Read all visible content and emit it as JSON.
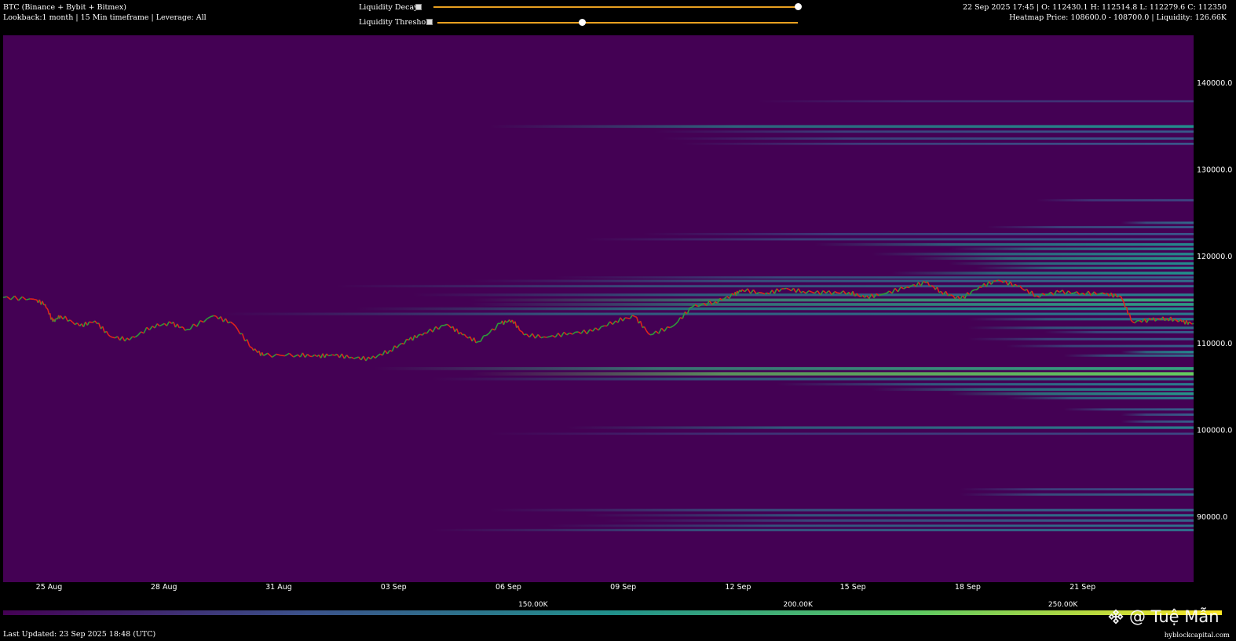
{
  "header": {
    "instrument": "BTC (Binance + Bybit + Bitmex)",
    "lookback": "Lookback:1 month | 15 Min timeframe | Leverage: All",
    "ohlc": "22 Sep 2025 17:45 | O: 112430.1 H: 112514.8 L: 112279.6 C: 112350",
    "heatmap_info": "Heatmap Price: 108600.0 - 108700.0 | Liquidity: 126.66K"
  },
  "controls": {
    "liquidity_decay": {
      "label": "Liquidity Decay",
      "value": 1.0
    },
    "liquidity_threshold": {
      "label": "Liquidity Threshold",
      "value": 0.4
    }
  },
  "footer": {
    "last_updated": "Last Updated: 23 Sep 2025 18:48 (UTC)",
    "site": "hyblockcapital.com"
  },
  "watermark": {
    "text": "@ Tuệ Mẫn"
  },
  "colors": {
    "background": "#440154",
    "price_up": "#2e9b3a",
    "price_down": "#e0241b",
    "slider": "#e8a020"
  },
  "chart_data": {
    "type": "heatmap",
    "x_ticks": [
      "25 Aug",
      "28 Aug",
      "31 Aug",
      "03 Sep",
      "06 Sep",
      "09 Sep",
      "12 Sep",
      "15 Sep",
      "18 Sep",
      "21 Sep"
    ],
    "x_tick_days": [
      2,
      5,
      8,
      11,
      14,
      17,
      20,
      23,
      26,
      29
    ],
    "x_range_days": [
      0.8,
      31.9
    ],
    "y_ticks": [
      "140000.0",
      "130000.0",
      "120000.0",
      "110000.0",
      "100000.0",
      "90000.0"
    ],
    "y_tick_values": [
      140000,
      130000,
      120000,
      110000,
      100000,
      90000
    ],
    "ylim": [
      82500,
      145500
    ],
    "colorbar": {
      "labels": [
        "150.00K",
        "200.00K",
        "250.00K"
      ],
      "label_values": [
        150000,
        200000,
        250000
      ],
      "range": [
        50000,
        280000
      ]
    },
    "price_path": [
      [
        0.8,
        115300
      ],
      [
        1.6,
        115100
      ],
      [
        1.9,
        114500
      ],
      [
        2.1,
        112500
      ],
      [
        2.3,
        113200
      ],
      [
        2.8,
        112000
      ],
      [
        3.2,
        112600
      ],
      [
        3.6,
        110800
      ],
      [
        4.1,
        110400
      ],
      [
        4.7,
        112000
      ],
      [
        5.2,
        112300
      ],
      [
        5.6,
        111600
      ],
      [
        6.3,
        113200
      ],
      [
        6.8,
        112300
      ],
      [
        7.3,
        109500
      ],
      [
        7.6,
        108600
      ],
      [
        8.5,
        108700
      ],
      [
        9.0,
        108500
      ],
      [
        9.4,
        108700
      ],
      [
        9.9,
        108400
      ],
      [
        10.4,
        108200
      ],
      [
        10.9,
        109200
      ],
      [
        11.4,
        110400
      ],
      [
        11.8,
        111200
      ],
      [
        12.4,
        112200
      ],
      [
        12.8,
        111000
      ],
      [
        13.2,
        110200
      ],
      [
        13.8,
        112300
      ],
      [
        14.1,
        112700
      ],
      [
        14.4,
        111000
      ],
      [
        15.0,
        110700
      ],
      [
        15.6,
        111200
      ],
      [
        16.2,
        111400
      ],
      [
        16.8,
        112600
      ],
      [
        17.3,
        113100
      ],
      [
        17.7,
        111000
      ],
      [
        18.3,
        112000
      ],
      [
        18.8,
        114200
      ],
      [
        19.4,
        114800
      ],
      [
        19.9,
        115600
      ],
      [
        20.1,
        116200
      ],
      [
        20.7,
        115700
      ],
      [
        21.2,
        116300
      ],
      [
        21.7,
        116000
      ],
      [
        22.3,
        115800
      ],
      [
        22.9,
        115900
      ],
      [
        23.3,
        115300
      ],
      [
        23.8,
        115700
      ],
      [
        24.4,
        116500
      ],
      [
        24.9,
        117000
      ],
      [
        25.3,
        116000
      ],
      [
        25.8,
        115100
      ],
      [
        26.3,
        116500
      ],
      [
        26.8,
        117300
      ],
      [
        27.3,
        116600
      ],
      [
        27.8,
        115500
      ],
      [
        28.4,
        115900
      ],
      [
        29.0,
        115800
      ],
      [
        29.6,
        115700
      ],
      [
        30.0,
        115400
      ],
      [
        30.3,
        112500
      ],
      [
        30.8,
        112700
      ],
      [
        31.2,
        112900
      ],
      [
        31.6,
        112500
      ],
      [
        31.9,
        112300
      ]
    ],
    "liquidity_bands": [
      {
        "price": 137900,
        "start_day": 20.5,
        "intensity": 0.18
      },
      {
        "price": 135000,
        "start_day": 13.5,
        "intensity": 0.48
      },
      {
        "price": 134400,
        "start_day": 17.8,
        "intensity": 0.28
      },
      {
        "price": 133600,
        "start_day": 18.0,
        "intensity": 0.28
      },
      {
        "price": 133000,
        "start_day": 18.5,
        "intensity": 0.26
      },
      {
        "price": 126500,
        "start_day": 27.8,
        "intensity": 0.22
      },
      {
        "price": 123900,
        "start_day": 30.0,
        "intensity": 0.34
      },
      {
        "price": 123400,
        "start_day": 26.5,
        "intensity": 0.28
      },
      {
        "price": 122600,
        "start_day": 17.5,
        "intensity": 0.26
      },
      {
        "price": 122000,
        "start_day": 16.0,
        "intensity": 0.28
      },
      {
        "price": 121400,
        "start_day": 22.0,
        "intensity": 0.46
      },
      {
        "price": 120900,
        "start_day": 25.5,
        "intensity": 0.46
      },
      {
        "price": 120300,
        "start_day": 23.5,
        "intensity": 0.46
      },
      {
        "price": 119800,
        "start_day": 24.5,
        "intensity": 0.52
      },
      {
        "price": 119200,
        "start_day": 25.5,
        "intensity": 0.46
      },
      {
        "price": 118700,
        "start_day": 26.2,
        "intensity": 0.46
      },
      {
        "price": 118100,
        "start_day": 24.0,
        "intensity": 0.5
      },
      {
        "price": 117600,
        "start_day": 15.2,
        "intensity": 0.32
      },
      {
        "price": 117200,
        "start_day": 13.0,
        "intensity": 0.36
      },
      {
        "price": 116600,
        "start_day": 9.5,
        "intensity": 0.34
      },
      {
        "price": 115600,
        "start_day": 11.5,
        "intensity": 0.42
      },
      {
        "price": 115000,
        "start_day": 13.0,
        "intensity": 0.6
      },
      {
        "price": 114500,
        "start_day": 13.0,
        "intensity": 0.55
      },
      {
        "price": 114000,
        "start_day": 10.0,
        "intensity": 0.5
      },
      {
        "price": 113400,
        "start_day": 6.5,
        "intensity": 0.4
      },
      {
        "price": 112800,
        "start_day": 26.0,
        "intensity": 0.4
      },
      {
        "price": 111800,
        "start_day": 26.0,
        "intensity": 0.36
      },
      {
        "price": 111300,
        "start_day": 28.0,
        "intensity": 0.3
      },
      {
        "price": 110500,
        "start_day": 26.0,
        "intensity": 0.3
      },
      {
        "price": 109700,
        "start_day": 27.0,
        "intensity": 0.3
      },
      {
        "price": 109000,
        "start_day": 30.0,
        "intensity": 0.46
      },
      {
        "price": 108600,
        "start_day": 28.5,
        "intensity": 0.36
      },
      {
        "price": 107100,
        "start_day": 10.5,
        "intensity": 0.58
      },
      {
        "price": 106500,
        "start_day": 13.0,
        "intensity": 0.76
      },
      {
        "price": 105900,
        "start_day": 12.0,
        "intensity": 0.4
      },
      {
        "price": 105300,
        "start_day": 21.0,
        "intensity": 0.4
      },
      {
        "price": 104700,
        "start_day": 23.5,
        "intensity": 0.48
      },
      {
        "price": 104200,
        "start_day": 25.5,
        "intensity": 0.52
      },
      {
        "price": 103700,
        "start_day": 27.0,
        "intensity": 0.4
      },
      {
        "price": 102400,
        "start_day": 28.5,
        "intensity": 0.3
      },
      {
        "price": 101800,
        "start_day": 30.0,
        "intensity": 0.3
      },
      {
        "price": 101000,
        "start_day": 30.0,
        "intensity": 0.3
      },
      {
        "price": 100300,
        "start_day": 15.5,
        "intensity": 0.42
      },
      {
        "price": 99600,
        "start_day": 13.5,
        "intensity": 0.22
      },
      {
        "price": 93200,
        "start_day": 25.8,
        "intensity": 0.26
      },
      {
        "price": 92600,
        "start_day": 25.8,
        "intensity": 0.34
      },
      {
        "price": 90800,
        "start_day": 13.5,
        "intensity": 0.34
      },
      {
        "price": 90200,
        "start_day": 16.0,
        "intensity": 0.38
      },
      {
        "price": 89600,
        "start_day": 16.5,
        "intensity": 0.32
      },
      {
        "price": 89000,
        "start_day": 15.0,
        "intensity": 0.36
      },
      {
        "price": 88500,
        "start_day": 12.0,
        "intensity": 0.36
      }
    ]
  }
}
